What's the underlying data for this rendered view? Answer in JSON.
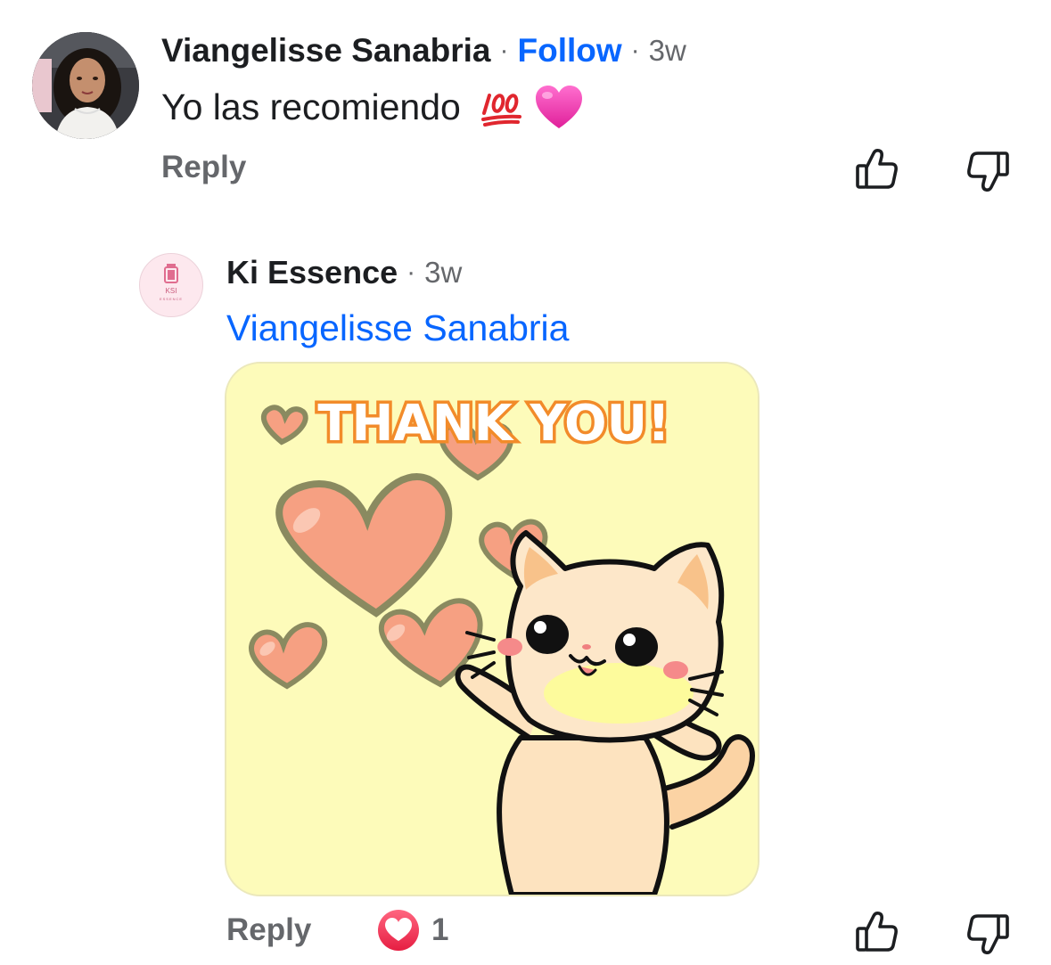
{
  "comment": {
    "author": "Viangelisse Sanabria",
    "follow_label": "Follow",
    "time": "3w",
    "text": "Yo las recomiendo",
    "reply_label": "Reply"
  },
  "reply": {
    "author": "Ki Essence",
    "avatar_text": "KSI",
    "avatar_subtext": "ESSENCE",
    "time": "3w",
    "mention": "Viangelisse Sanabria",
    "sticker_text": "THANK YOU!",
    "reply_label": "Reply",
    "reaction_count": "1"
  },
  "icons": {
    "like": "thumbs-up-icon",
    "dislike": "thumbs-down-icon",
    "love_reaction": "love-reaction-icon",
    "hundred": "hundred-points-emoji",
    "heart": "pink-heart-emoji"
  },
  "colors": {
    "link": "#0866ff",
    "secondary_text": "#65676b",
    "primary_text": "#1c1e21",
    "reaction_red": "#f0284a"
  }
}
